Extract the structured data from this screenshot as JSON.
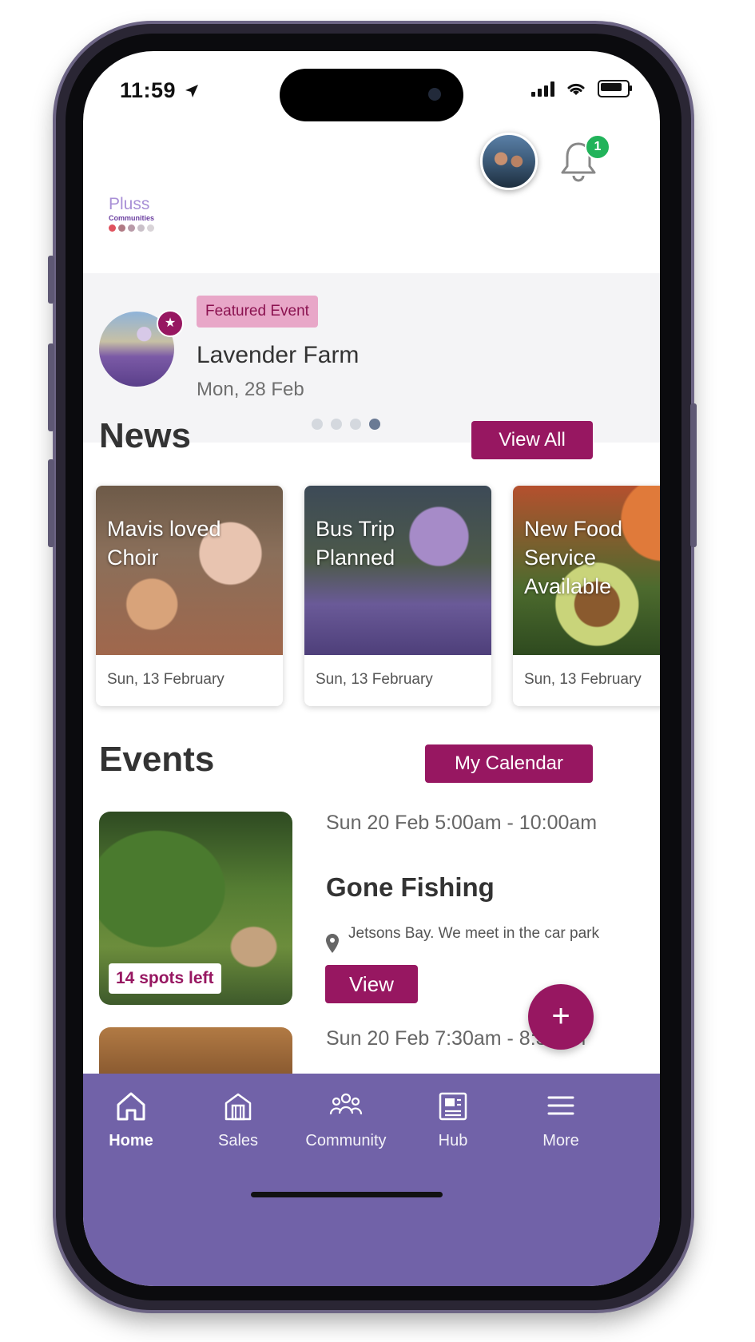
{
  "status_bar": {
    "time": "11:59"
  },
  "header": {
    "logo": {
      "name": "Pluss",
      "sub": "Communities"
    },
    "notification_count": "1"
  },
  "featured": {
    "tag": "Featured Event",
    "title": "Lavender Farm",
    "date": "Mon, 28 Feb",
    "page_index": 4,
    "page_count": 4
  },
  "news": {
    "title": "News",
    "view_all_label": "View All",
    "items": [
      {
        "title": "Mavis loved\nChoir",
        "date": "Sun, 13 February"
      },
      {
        "title": "Bus Trip\nPlanned",
        "date": "Sun, 13 February"
      },
      {
        "title": "New Food\nService\nAvailable",
        "date": "Sun, 13 February"
      }
    ]
  },
  "events": {
    "title": "Events",
    "calendar_label": "My Calendar",
    "items": [
      {
        "time": "Sun 20 Feb 5:00am - 10:00am",
        "title": "Gone Fishing",
        "location": "Jetsons Bay. We meet in the car park",
        "spots": "14 spots left",
        "view_label": "View"
      },
      {
        "time": "Sun 20 Feb 7:30am - 8:30am"
      }
    ]
  },
  "fab_label": "+",
  "tabs": [
    {
      "label": "Home",
      "icon": "home-icon",
      "active": true
    },
    {
      "label": "Sales",
      "icon": "store-icon"
    },
    {
      "label": "Community",
      "icon": "people-icon"
    },
    {
      "label": "Hub",
      "icon": "newspaper-icon"
    },
    {
      "label": "More",
      "icon": "menu-icon"
    }
  ],
  "colors": {
    "primary": "#971761",
    "tabbar": "#7162a8",
    "featured_tag_bg": "#e8a7c8",
    "badge": "#21b35a"
  }
}
